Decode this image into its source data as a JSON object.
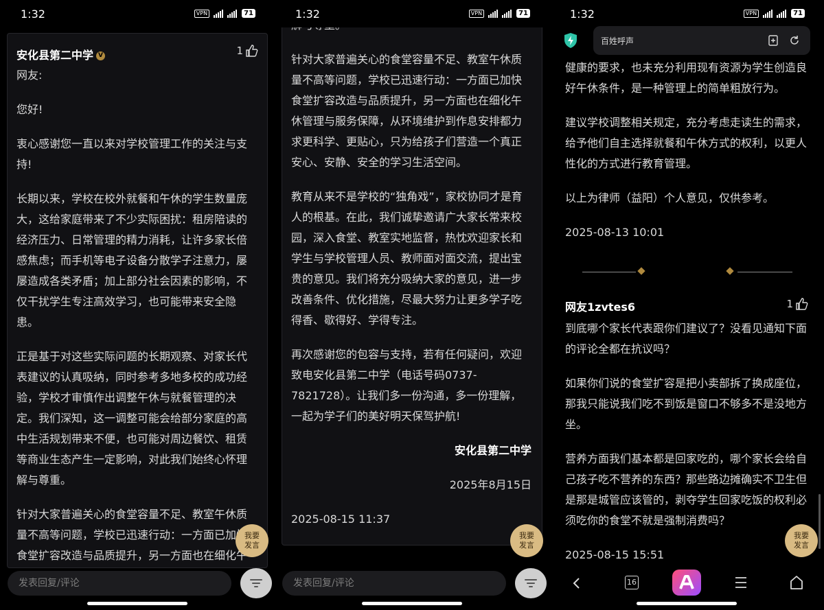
{
  "status": {
    "time": "1:32",
    "vpn": "VPN",
    "battery": "71"
  },
  "panel1": {
    "author": "安化县第二中学",
    "likes": "1",
    "paragraphs": [
      "网友:",
      "您好!",
      "衷心感谢您一直以来对学校管理工作的关注与支持!",
      "长期以来，学校在校外就餐和午休的学生数量庞大，这给家庭带来了不少实际困扰：租房陪读的经济压力、日常管理的精力消耗，让许多家长倍感焦虑；而手机等电子设备分散学子注意力，屡屡造成各类矛盾；加上部分社会因素的影响，不仅干扰学生专注高效学习，也可能带来安全隐患。",
      "正是基于对这些实际问题的长期观察、对家长代表建议的认真吸纳，同时参考多地多校的成功经验，学校才审慎作出调整午休与就餐管理的决定。我们深知，这一调整可能会给部分家庭的高中生活规划带来不便，也可能对周边餐饮、租赁等商业生态产生一定影响，对此我们始终心怀理解与尊重。",
      "针对大家普遍关心的食堂容量不足、教室午休质量不高等问题，学校已迅速行动：一方面已加快食堂扩容改造与品质提升，另一方面也在细化午休管理与服务保障"
    ],
    "speak_label": "我要发言",
    "comment_placeholder": "发表回复/评论"
  },
  "panel2": {
    "paragraphs": [
      "等商业生态产生一定影响，对此我们始终心怀理解与尊重。",
      "针对大家普遍关心的食堂容量不足、教室午休质量不高等问题，学校已迅速行动：一方面已加快食堂扩容改造与品质提升，另一方面也在细化午休管理与服务保障，从环境维护到作息安排都力求更科学、更贴心，只为给孩子们营造一个真正安心、安静、安全的学习生活空间。",
      "教育从来不是学校的“独角戏”，家校协同才是育人的根基。在此，我们诚挚邀请广大家长常来校园，深入食堂、教室实地监督，热忱欢迎家长和学生与学校管理人员、教师面对面交流，提出宝贵的意见。我们将充分吸纳大家的意见，进一步改善条件、优化措施，尽最大努力让更多学子吃得香、歇得好、学得专注。",
      "再次感谢您的包容与支持，若有任何疑问，欢迎致电安化县第二中学（电话号码0737-7821728）。让我们多一份沟通，多一份理解，一起为学子们的美好明天保驾护航!"
    ],
    "signature": "安化县第二中学",
    "date": "2025年8月15日",
    "timestamp": "2025-08-15 11:37",
    "speak_label": "我要发言",
    "comment_placeholder": "发表回复/评论"
  },
  "panel3": {
    "search_text": "百姓呼声",
    "paragraphs_top": [
      "健康的要求，也未充分利用现有资源为学生创造良好午休条件，是一种管理上的简单粗放行为。",
      "建议学校调整相关规定，充分考虑走读生的需求，给予他们自主选择就餐和午休方式的权利，以更人性化的方式进行教育管理。",
      "以上为律师（益阳）个人意见，仅供参考。"
    ],
    "timestamp_top": "2025-08-13 10:01",
    "reply_author": "网友1zvtes6",
    "reply_likes": "1",
    "reply_paragraphs": [
      "到底哪个家长代表跟你们建议了？没看见通知下面的评论全都在抗议吗？",
      "如果你们说的食堂扩容是把小卖部拆了换成座位，那我只能说我们吃不到饭是窗口不够多不是没地方坐。",
      "营养方面我们基本都是回家吃的，哪个家长会给自己孩子吃不营养的东西？那些路边摊确实不卫生但是那是城管应该管的，剥夺学生回家吃饭的权利必须吃你的食堂不就是强制消费吗？"
    ],
    "timestamp_reply": "2025-08-15 15:51",
    "speak_label": "我要发言",
    "tab_count": "16"
  },
  "colors": {
    "card_bg": "#111114",
    "accent_gold": "#d9bb83",
    "shield": "#2ec4a8",
    "app_gradient": "#ff4f7a"
  }
}
